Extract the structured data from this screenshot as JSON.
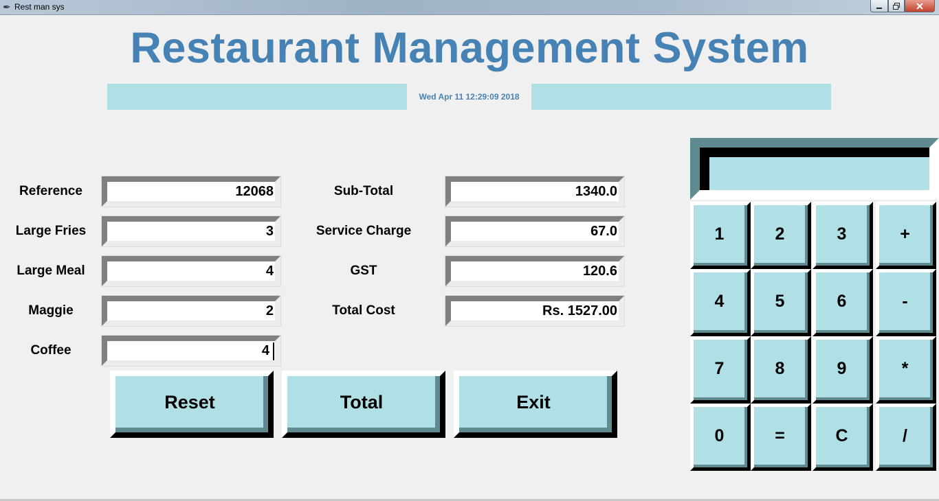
{
  "window": {
    "title": "Rest man sys",
    "app_icon": "feather-icon"
  },
  "header": {
    "title": "Restaurant Management System",
    "datetime": "Wed Apr 11 12:29:09 2018"
  },
  "left_fields": [
    {
      "label": "Reference",
      "value": "12068"
    },
    {
      "label": "Large Fries",
      "value": "3"
    },
    {
      "label": "Large Meal",
      "value": "4"
    },
    {
      "label": "Maggie",
      "value": "2"
    },
    {
      "label": "Coffee",
      "value": "4"
    }
  ],
  "right_fields": [
    {
      "label": "Sub-Total",
      "value": "1340.0"
    },
    {
      "label": "Service Charge",
      "value": "67.0"
    },
    {
      "label": "GST",
      "value": "120.6"
    },
    {
      "label": "Total Cost",
      "value": "Rs. 1527.00"
    }
  ],
  "actions": {
    "reset": "Reset",
    "total": "Total",
    "exit": "Exit"
  },
  "calculator": {
    "display": "",
    "keys": [
      "1",
      "2",
      "3",
      "+",
      "4",
      "5",
      "6",
      "-",
      "7",
      "8",
      "9",
      "*",
      "0",
      "=",
      "C",
      "/"
    ]
  },
  "colors": {
    "title": "#4682b4",
    "accent": "#b0dfe5",
    "shadow": "#5f8a8f",
    "background": "#f0f0f0"
  }
}
